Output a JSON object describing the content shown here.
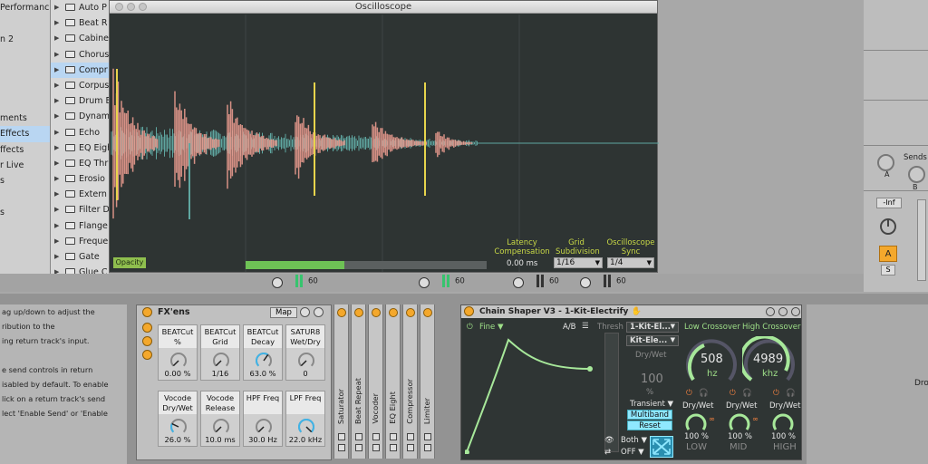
{
  "left_sidebar": {
    "items": [
      "Performanc",
      "",
      "n 2",
      "",
      "",
      "",
      "",
      "ments",
      "Effects",
      "ffects",
      "r Live",
      "s",
      "",
      "s",
      ""
    ],
    "selected_index": 8
  },
  "browser": {
    "items": [
      {
        "label": "Auto P",
        "selected": false
      },
      {
        "label": "Beat R",
        "selected": false
      },
      {
        "label": "Cabine",
        "selected": false
      },
      {
        "label": "Chorus",
        "selected": false
      },
      {
        "label": "Compr",
        "selected": true
      },
      {
        "label": "Corpus",
        "selected": false
      },
      {
        "label": "Drum E",
        "selected": false
      },
      {
        "label": "Dynam",
        "selected": false
      },
      {
        "label": "Echo",
        "selected": false
      },
      {
        "label": "EQ Eigh",
        "selected": false
      },
      {
        "label": "EQ Thr",
        "selected": false
      },
      {
        "label": "Erosio",
        "selected": false
      },
      {
        "label": "Extern",
        "selected": false
      },
      {
        "label": "Filter D",
        "selected": false
      },
      {
        "label": "Flange",
        "selected": false
      },
      {
        "label": "Freque",
        "selected": false
      },
      {
        "label": "Gate",
        "selected": false
      },
      {
        "label": "Glue C",
        "selected": false
      }
    ]
  },
  "oscilloscope": {
    "title": "Oscilloscope",
    "opacity_label": "Opacity",
    "latency_label": "Latency Compensation",
    "latency_value": "0.00 ms",
    "grid_label": "Grid Subdivision",
    "grid_value": "1/16",
    "sync_label": "Oscilloscope Sync",
    "sync_value": "1/4",
    "progress": 0.41,
    "colors": {
      "wave_main": "#e99a8e",
      "wave_secondary": "#5fa6a0",
      "marker": "#e7d44c",
      "grid": "#3f4544"
    }
  },
  "mixer_strip": {
    "values": [
      "60",
      "60",
      "60",
      "60"
    ]
  },
  "right_mixer": {
    "sends_label": "Sends",
    "knob_a": "A",
    "knob_b": "B",
    "volume_value": "-Inf",
    "track_button": "A",
    "solo_button": "S"
  },
  "info_text": [
    "ag up/down to adjust the",
    "ribution to the",
    "ing return track's input.",
    "",
    "e send controls in return",
    "isabled by default. To enable",
    "lick on a return track's send",
    "lect 'Enable Send' or 'Enable"
  ],
  "fxens": {
    "title": "FX'ens",
    "map_label": "Map",
    "macros": [
      {
        "label": "BEATCut %",
        "value": "0.00 %",
        "level": 0.0
      },
      {
        "label": "BEATCut Grid",
        "value": "1/16",
        "level": 0.0
      },
      {
        "label": "BEATCut Decay",
        "value": "63.0 %",
        "level": 0.63
      },
      {
        "label": "SATUR8 Wet/Dry",
        "value": "0",
        "level": 0.0
      },
      {
        "label": "Vocode Dry/Wet",
        "value": "26.0 %",
        "level": 0.26
      },
      {
        "label": "Vocode Release",
        "value": "10.0 ms",
        "level": 0.0
      },
      {
        "label": "HPF Freq",
        "value": "30.0 Hz",
        "level": 0.0
      },
      {
        "label": "LPF Freq",
        "value": "22.0 kHz",
        "level": 1.0
      }
    ]
  },
  "rack_devices": [
    "Saturator",
    "Beat Repeat",
    "Vocoder",
    "EQ Eight",
    "Compressor",
    "Limiter"
  ],
  "chain_shaper": {
    "title": "Chain Shaper V3 - 1-Kit-Electrify",
    "mode_label": "Fine",
    "ab_label": "A/B",
    "thresh_label": "Thresh",
    "chain_select_1": "1-Kit-El...",
    "chain_select_2": "Kit-Ele...",
    "drywet_label": "Dry/Wet",
    "drywet_value": "100",
    "drywet_unit": "%",
    "transient_label": "Transient",
    "multiband_label": "Multiband",
    "reset_label": "Reset",
    "both_label": "Both",
    "off_label": "OFF",
    "low_crossover_label": "Low Crossover",
    "high_crossover_label": "High Crossover",
    "low_crossover_value": "508",
    "low_crossover_unit": "hz",
    "high_crossover_value": "4989",
    "high_crossover_unit": "khz",
    "bands": [
      {
        "label": "LOW",
        "drywet": "Dry/Wet",
        "value": "100 %"
      },
      {
        "label": "MID",
        "drywet": "Dry/Wet",
        "value": "100 %"
      },
      {
        "label": "HIGH",
        "drywet": "Dry/Wet",
        "value": "100 %"
      }
    ],
    "accent": "#9fe089"
  },
  "right_edge_text": "Dro"
}
